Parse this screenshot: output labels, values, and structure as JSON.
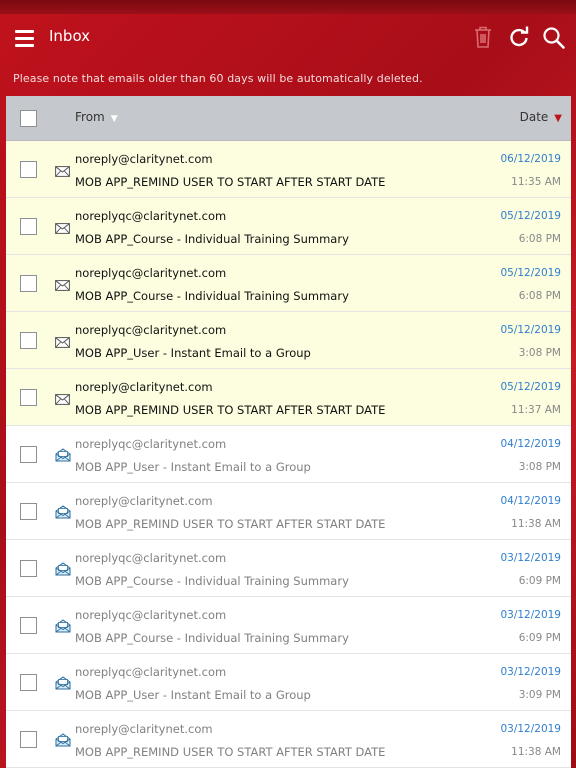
{
  "header": {
    "title": "Inbox"
  },
  "notice": "Please note that emails older than 60 days will be automatically deleted.",
  "table": {
    "col_from": "From",
    "col_date": "Date"
  },
  "emails": [
    {
      "from": "noreply@claritynet.com",
      "subject": "MOB APP_REMIND USER TO START AFTER START DATE",
      "date": "06/12/2019",
      "time": "11:35 AM",
      "read": false
    },
    {
      "from": "noreplyqc@claritynet.com",
      "subject": "MOB APP_Course - Individual Training Summary",
      "date": "05/12/2019",
      "time": "6:08 PM",
      "read": false
    },
    {
      "from": "noreplyqc@claritynet.com",
      "subject": "MOB APP_Course - Individual Training Summary",
      "date": "05/12/2019",
      "time": "6:08 PM",
      "read": false
    },
    {
      "from": "noreplyqc@claritynet.com",
      "subject": "MOB APP_User - Instant Email to a Group",
      "date": "05/12/2019",
      "time": "3:08 PM",
      "read": false
    },
    {
      "from": "noreply@claritynet.com",
      "subject": "MOB APP_REMIND USER TO START AFTER START DATE",
      "date": "05/12/2019",
      "time": "11:37 AM",
      "read": false
    },
    {
      "from": "noreplyqc@claritynet.com",
      "subject": "MOB APP_User - Instant Email to a Group",
      "date": "04/12/2019",
      "time": "3:08 PM",
      "read": true
    },
    {
      "from": "noreply@claritynet.com",
      "subject": "MOB APP_REMIND USER TO START AFTER START DATE",
      "date": "04/12/2019",
      "time": "11:38 AM",
      "read": true
    },
    {
      "from": "noreplyqc@claritynet.com",
      "subject": "MOB APP_Course - Individual Training Summary",
      "date": "03/12/2019",
      "time": "6:09 PM",
      "read": true
    },
    {
      "from": "noreplyqc@claritynet.com",
      "subject": "MOB APP_Course - Individual Training Summary",
      "date": "03/12/2019",
      "time": "6:09 PM",
      "read": true
    },
    {
      "from": "noreplyqc@claritynet.com",
      "subject": "MOB APP_User - Instant Email to a Group",
      "date": "03/12/2019",
      "time": "3:09 PM",
      "read": true
    },
    {
      "from": "noreply@claritynet.com",
      "subject": "MOB APP_REMIND USER TO START AFTER START DATE",
      "date": "03/12/2019",
      "time": "11:38 AM",
      "read": true
    }
  ],
  "colors": {
    "accent": "#c0121d",
    "date_blue": "#2f7fd0",
    "unread_bg": "#fdfde0"
  }
}
